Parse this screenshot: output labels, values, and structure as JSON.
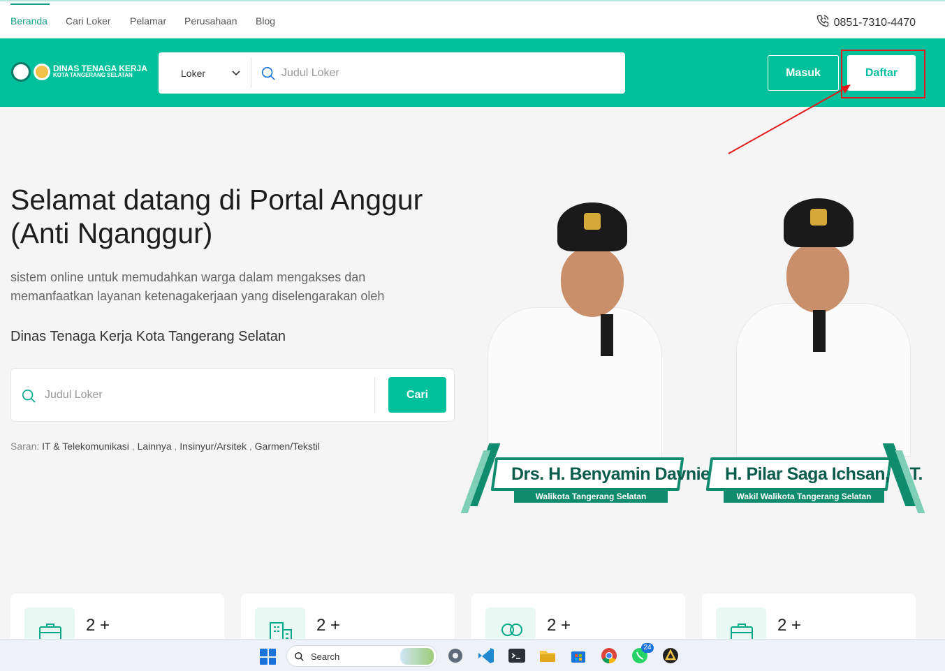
{
  "nav": {
    "links": [
      "Beranda",
      "Cari Loker",
      "Pelamar",
      "Perusahaan",
      "Blog"
    ],
    "phone": "0851-7310-4470"
  },
  "header": {
    "logo_line1": "DINAS TENAGA KERJA",
    "logo_line2": "KOTA TANGERANG SELATAN",
    "search_category": "Loker",
    "search_placeholder": "Judul Loker",
    "login_label": "Masuk",
    "register_label": "Daftar"
  },
  "hero": {
    "title": "Selamat datang di Portal Anggur (Anti Nganggur)",
    "description": "sistem online untuk memudahkan warga dalam mengakses dan memanfaatkan layanan ketenagakerjaan yang diselengarakan oleh",
    "subtitle": "Dinas Tenaga Kerja Kota Tangerang Selatan",
    "search_placeholder": "Judul Loker",
    "search_button": "Cari",
    "suggestions_label": "Saran:",
    "suggestions": [
      "IT & Telekomunikasi",
      "Lainnya",
      "Insinyur/Arsitek",
      "Garmen/Tekstil"
    ]
  },
  "officials": [
    {
      "name": "Drs. H. Benyamin Davnie",
      "role": "Walikota Tangerang Selatan"
    },
    {
      "name": "H. Pilar Saga Ichsan, S.T.",
      "role": "Wakil Walikota Tangerang Selatan"
    }
  ],
  "stats": [
    {
      "value": "2 +",
      "icon": "briefcase-icon"
    },
    {
      "value": "2 +",
      "icon": "building-icon"
    },
    {
      "value": "2 +",
      "icon": "users-icon"
    },
    {
      "value": "2 +",
      "icon": "briefcase-icon"
    }
  ],
  "taskbar": {
    "search_label": "Search",
    "whatsapp_badge": "24"
  },
  "colors": {
    "brand": "#00c19c",
    "highlight": "#e01b1b"
  }
}
